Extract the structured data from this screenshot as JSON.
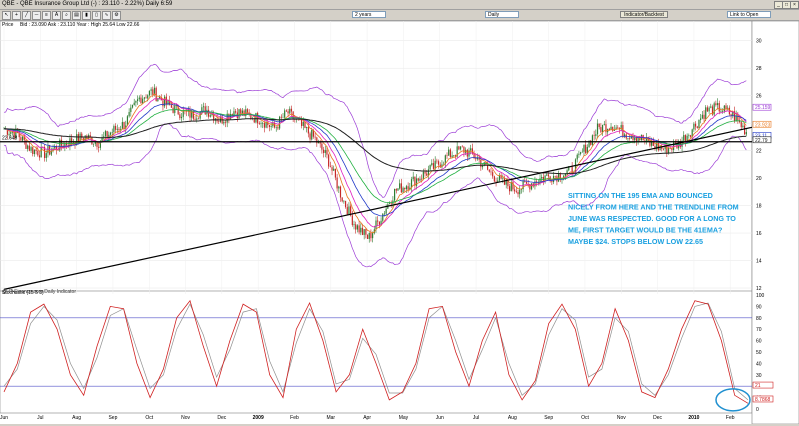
{
  "window": {
    "title": "QBE - QBE Insurance Group Ltd (-) : 23.110 - 2.22%)   Daily   6:59"
  },
  "toolbar": {
    "range_select": "2 years",
    "interval_select": "Daily",
    "indicator_button": "Indicator/Backtest",
    "link_select": "Link to Open"
  },
  "price_panel": {
    "label": "Price",
    "info_line": "Bid : 23.090  Ask : 23.110   Year : High 25.64  Low 22.66",
    "left_level_label": "22.648",
    "watermark": "@ IT-Finance.com  Daily Indicator",
    "right_tags": [
      "25.159",
      "23.923",
      "23.11",
      "22.79"
    ]
  },
  "stoch_panel": {
    "label": "Stochastic (15 5 3)",
    "right_tags": [
      "21",
      "8.7868"
    ]
  },
  "annotation": {
    "text_lines": [
      "SITTING ON THE 195 EMA AND BOUNCED",
      "NICELY FROM HERE AND THE TRENDLINE FROM",
      "JUNE WAS RESPECTED. GOOD FOR A LONG TO",
      "ME, FIRST TARGET WOULD BE THE 41EMA?",
      "MAYBE $24. STOPS BELOW LOW 22.65"
    ]
  },
  "colors": {
    "bull": "#2e7d32",
    "bear": "#c62828",
    "bollinger": "#9c3cd6",
    "ema_fast": "#e87820",
    "ema_blue": "#2038c8",
    "ema_green": "#20b040",
    "ema_magenta": "#e020c0",
    "ema_195": "#202020",
    "stoch_k": "#d02020",
    "stoch_d": "#909090",
    "annotation": "#1aa0e0",
    "circle": "#2090d0"
  },
  "chart_data": [
    {
      "type": "candlestick",
      "title": "Price",
      "ylim": [
        12,
        31
      ],
      "yticks": [
        12,
        14,
        16,
        18,
        20,
        22,
        24,
        26,
        28,
        30
      ],
      "x_ticks": [
        "Jun",
        "Jul",
        "Aug",
        "Sep",
        "Oct",
        "Nov",
        "Dec",
        "2009",
        "Feb",
        "Mar",
        "Apr",
        "May",
        "Jun",
        "Jul",
        "Aug",
        "Sep",
        "Oct",
        "Nov",
        "Dec",
        "2010",
        "Feb"
      ],
      "hlines": [
        22.648
      ],
      "trendline": {
        "from": [
          0,
          11.9
        ],
        "to": [
          20.6,
          23.7
        ]
      },
      "close_path": [
        23.6,
        23.2,
        22.1,
        21.8,
        22.3,
        22.7,
        23.0,
        22.6,
        23.4,
        24.0,
        25.8,
        26.3,
        25.4,
        24.8,
        24.6,
        25.0,
        24.2,
        24.9,
        24.6,
        24.3,
        23.6,
        24.8,
        23.8,
        22.9,
        21.4,
        18.7,
        16.6,
        15.6,
        17.3,
        19.1,
        19.6,
        20.2,
        20.9,
        21.7,
        22.1,
        21.5,
        20.4,
        19.6,
        19.2,
        19.6,
        20.1,
        20.2,
        20.5,
        22.1,
        23.6,
        23.9,
        23.3,
        23.0,
        22.4,
        22.1,
        22.5,
        23.6,
        24.9,
        25.1,
        24.6,
        23.4
      ]
    },
    {
      "type": "line",
      "title": "Stochastic (15 5 3)",
      "ylim": [
        0,
        100
      ],
      "yticks": [
        0,
        10,
        20,
        30,
        40,
        50,
        60,
        70,
        80,
        90,
        100
      ],
      "hlines": [
        20,
        80
      ],
      "series": [
        {
          "name": "%K",
          "values": [
            15,
            40,
            85,
            92,
            70,
            30,
            12,
            55,
            90,
            88,
            40,
            10,
            35,
            80,
            95,
            55,
            20,
            60,
            92,
            85,
            30,
            10,
            70,
            93,
            60,
            15,
            30,
            70,
            40,
            8,
            15,
            40,
            88,
            90,
            50,
            20,
            60,
            85,
            30,
            8,
            25,
            75,
            92,
            70,
            20,
            40,
            88,
            60,
            15,
            10,
            35,
            70,
            95,
            92,
            60,
            12,
            5
          ]
        },
        {
          "name": "%D",
          "values": [
            20,
            35,
            75,
            90,
            78,
            40,
            18,
            45,
            82,
            88,
            52,
            18,
            30,
            70,
            92,
            65,
            28,
            52,
            85,
            88,
            42,
            15,
            58,
            88,
            68,
            22,
            26,
            62,
            48,
            14,
            14,
            35,
            80,
            90,
            60,
            26,
            52,
            80,
            40,
            12,
            22,
            65,
            88,
            78,
            28,
            35,
            80,
            68,
            22,
            12,
            30,
            62,
            90,
            93,
            68,
            18,
            8
          ]
        }
      ]
    }
  ]
}
